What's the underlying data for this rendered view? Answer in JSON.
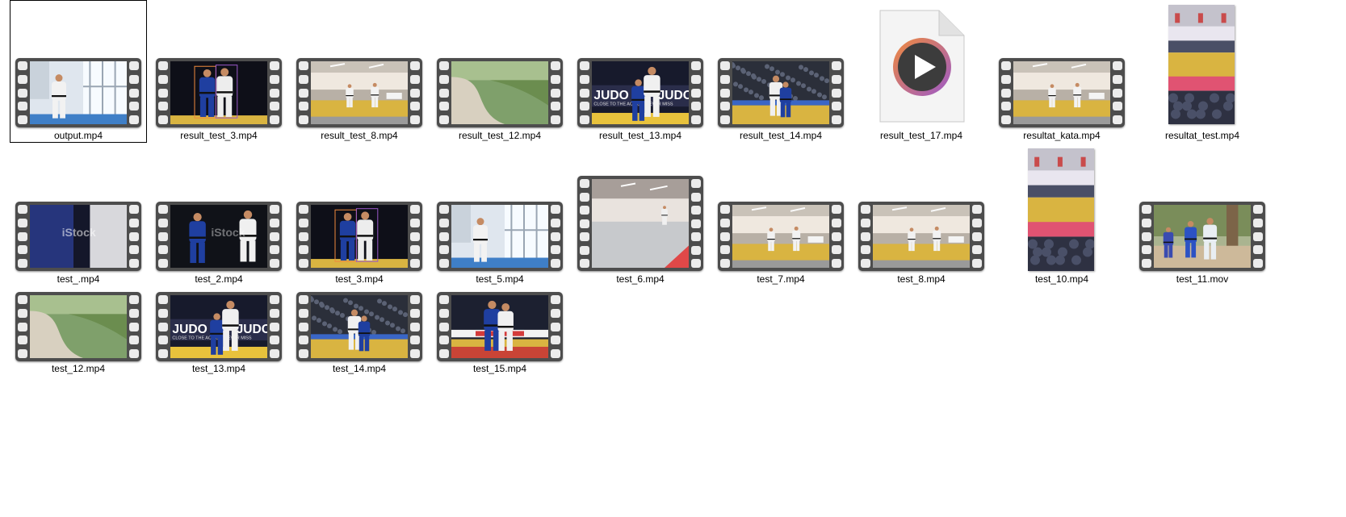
{
  "files": [
    {
      "name": "output.mp4",
      "selected": true,
      "thumb": "window-gym",
      "kind": "film"
    },
    {
      "name": "result_test_3.mp4",
      "thumb": "dark-blue-white",
      "kind": "film"
    },
    {
      "name": "result_test_8.mp4",
      "thumb": "hall-yellow",
      "kind": "film"
    },
    {
      "name": "result_test_12.mp4",
      "thumb": "path-grass",
      "kind": "film"
    },
    {
      "name": "result_test_13.mp4",
      "thumb": "judo-banner",
      "kind": "film"
    },
    {
      "name": "result_test_14.mp4",
      "thumb": "arena-crowd",
      "kind": "film"
    },
    {
      "name": "result_test_17.mp4",
      "thumb": "media-player-file",
      "kind": "doc"
    },
    {
      "name": "resultat_kata.mp4",
      "thumb": "hall-yellow",
      "kind": "film"
    },
    {
      "name": "resultat_test.mp4",
      "thumb": "vertical-hall",
      "kind": "portrait"
    },
    {
      "name": "test_.mp4",
      "thumb": "istock-blue",
      "kind": "film",
      "watermark": "iStock"
    },
    {
      "name": "test_2.mp4",
      "thumb": "istock-dark",
      "kind": "film",
      "watermark": "iStock"
    },
    {
      "name": "test_3.mp4",
      "thumb": "dark-blue-white",
      "kind": "film"
    },
    {
      "name": "test_5.mp4",
      "thumb": "window-gym",
      "kind": "film"
    },
    {
      "name": "test_6.mp4",
      "thumb": "grey-mat",
      "kind": "film"
    },
    {
      "name": "test_7.mp4",
      "thumb": "hall-yellow",
      "kind": "film"
    },
    {
      "name": "test_8.mp4",
      "thumb": "hall-yellow",
      "kind": "film"
    },
    {
      "name": "test_10.mp4",
      "thumb": "vertical-hall",
      "kind": "portrait"
    },
    {
      "name": "test_11.mov",
      "thumb": "runners-trees",
      "kind": "film"
    },
    {
      "name": "test_12.mp4",
      "thumb": "path-grass",
      "kind": "film"
    },
    {
      "name": "test_13.mp4",
      "thumb": "judo-banner",
      "kind": "film"
    },
    {
      "name": "test_14.mp4",
      "thumb": "arena-crowd",
      "kind": "film"
    },
    {
      "name": "test_15.mp4",
      "thumb": "arena-red",
      "kind": "film"
    }
  ],
  "banner_text": {
    "judo": "JUDO",
    "tagline": "CLOSE TO THE ACTION, NEVER MISS"
  },
  "colors": {
    "film_border": "#4d4d4d",
    "sprocket": "#ececec",
    "selection": "#000000",
    "judogi_blue": "#1f3fa0",
    "mat_yellow": "#d9b441",
    "player_orange": "#f08a3c",
    "player_purple": "#9b59c9"
  }
}
